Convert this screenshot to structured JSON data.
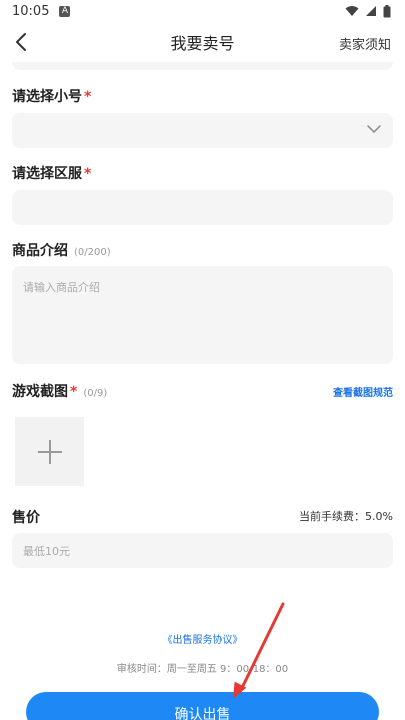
{
  "status_bar": {
    "time": "10:05",
    "notification_badge": "A",
    "icons": [
      "wifi-icon",
      "signal-icon",
      "battery-icon"
    ]
  },
  "nav": {
    "back_icon": "chevron-left-icon",
    "title": "我要卖号",
    "right_label": "卖家须知"
  },
  "form": {
    "account": {
      "label": "请选择小号",
      "required_mark": "*",
      "selected_value": "",
      "icon": "chevron-down-icon"
    },
    "server": {
      "label": "请选择区服",
      "required_mark": "*",
      "value": ""
    },
    "description": {
      "label": "商品介绍",
      "counter": "(0/200)",
      "placeholder": "请输入商品介绍",
      "value": ""
    },
    "screenshots": {
      "label": "游戏截图",
      "required_mark": "*",
      "counter": "(0/9)",
      "spec_link": "查看截图规范",
      "add_icon": "plus-icon"
    },
    "price": {
      "label": "售价",
      "fee_text": "当前手续费：5.0%",
      "placeholder": "最低10元",
      "value": ""
    }
  },
  "footer": {
    "agreement_link": "《出售服务协议》",
    "audit_time": "审核时间：周一至周五 9：00-18：00",
    "confirm_label": "确认出售"
  },
  "colors": {
    "accent": "#1e88f5",
    "link": "#1a73e8",
    "required": "#e53935",
    "annotation_arrow": "#e53935",
    "field_background": "#f5f5f5"
  }
}
